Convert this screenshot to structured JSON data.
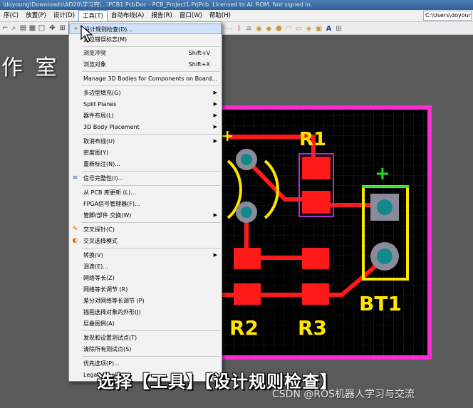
{
  "titlebar": {
    "text": "\\doyoung\\Downloads\\AD20\\学习完\\...\\PCB1.PcbDoc - PCB_Project1.PrjPcb. Licensed to AL ROM. Not signed in."
  },
  "menubar": {
    "items": [
      {
        "label": "序(C)"
      },
      {
        "label": "放置(P)"
      },
      {
        "label": "设计(D)"
      },
      {
        "label": "工具(T)"
      },
      {
        "label": "自动布线(A)"
      },
      {
        "label": "报告(R)"
      },
      {
        "label": "窗口(W)"
      },
      {
        "label": "帮助(H)"
      }
    ],
    "path": "C:\\Users\\doyoung\\"
  },
  "left_caption": "作 室",
  "dropdown": {
    "rows": [
      {
        "label": "设计规则检查(D)...",
        "shortcut": "",
        "arrow": false,
        "icon": "drc-icon"
      },
      {
        "label": "复位错误标志(M)",
        "shortcut": "",
        "arrow": false,
        "icon": ""
      },
      {
        "label": "浏览冲突",
        "shortcut": "Shift+V",
        "arrow": false,
        "icon": ""
      },
      {
        "label": "浏览对象",
        "shortcut": "Shift+X",
        "arrow": false,
        "icon": ""
      },
      {
        "label": "Manage 3D Bodies for Components on Board...",
        "shortcut": "",
        "arrow": false,
        "icon": ""
      },
      {
        "label": "多边型填充(G)",
        "shortcut": "",
        "arrow": true,
        "icon": ""
      },
      {
        "label": "Split Planes",
        "shortcut": "",
        "arrow": true,
        "icon": ""
      },
      {
        "label": "器件布局(L)",
        "shortcut": "",
        "arrow": true,
        "icon": ""
      },
      {
        "label": "3D Body Placement",
        "shortcut": "",
        "arrow": true,
        "icon": ""
      },
      {
        "label": "取消布线(U)",
        "shortcut": "",
        "arrow": true,
        "icon": ""
      },
      {
        "label": "密度图(Y)",
        "shortcut": "",
        "arrow": false,
        "icon": ""
      },
      {
        "label": "重新标注(N)...",
        "shortcut": "",
        "arrow": false,
        "icon": ""
      },
      {
        "label": "信号完整性(I)...",
        "shortcut": "",
        "arrow": false,
        "icon": "signal-icon"
      },
      {
        "label": "从 PCB 库更新 (L)...",
        "shortcut": "",
        "arrow": false,
        "icon": ""
      },
      {
        "label": "FPGA信号管理器(F)...",
        "shortcut": "",
        "arrow": false,
        "icon": ""
      },
      {
        "label": "管脚/部件 交换(W)",
        "shortcut": "",
        "arrow": true,
        "icon": ""
      },
      {
        "label": "交叉探针(C)",
        "shortcut": "",
        "arrow": false,
        "icon": "probe-icon"
      },
      {
        "label": "交叉选择模式",
        "shortcut": "",
        "arrow": false,
        "icon": "select-icon"
      },
      {
        "label": "转换(V)",
        "shortcut": "",
        "arrow": true,
        "icon": ""
      },
      {
        "label": "泪滴(E)...",
        "shortcut": "",
        "arrow": false,
        "icon": ""
      },
      {
        "label": "网络等长(Z)",
        "shortcut": "",
        "arrow": false,
        "icon": ""
      },
      {
        "label": "网络等长调节 (R)",
        "shortcut": "",
        "arrow": false,
        "icon": ""
      },
      {
        "label": "差分对网络等长调节 (P)",
        "shortcut": "",
        "arrow": false,
        "icon": ""
      },
      {
        "label": "描画选择对象的外形(J)",
        "shortcut": "",
        "arrow": false,
        "icon": ""
      },
      {
        "label": "层叠图例(A)",
        "shortcut": "",
        "arrow": false,
        "icon": ""
      },
      {
        "label": "发现和设置测试点(T)",
        "shortcut": "",
        "arrow": false,
        "icon": ""
      },
      {
        "label": "清除所有测试点(S)",
        "shortcut": "",
        "arrow": false,
        "icon": ""
      },
      {
        "label": "优先选项(P)...",
        "shortcut": "",
        "arrow": false,
        "icon": ""
      },
      {
        "label": "Legacy Tools",
        "shortcut": "",
        "arrow": true,
        "icon": ""
      }
    ]
  },
  "pcb": {
    "labels": {
      "r1": "R1",
      "r2": "R2",
      "r3": "R3",
      "bt1": "BT1",
      "plus": "+"
    },
    "colors": {
      "board_outline": "#ff2ad4",
      "pad": "#ff1a1a",
      "silkscreen": "#ffe600",
      "track": "#ff1a1a",
      "via": "#8a8a9a",
      "bt_plus": "#22dd22",
      "bg": "#000000"
    }
  },
  "subtitle": "选择【工具】【设计规则检查】",
  "watermark": "CSDN @ROS机器人学习与交流"
}
